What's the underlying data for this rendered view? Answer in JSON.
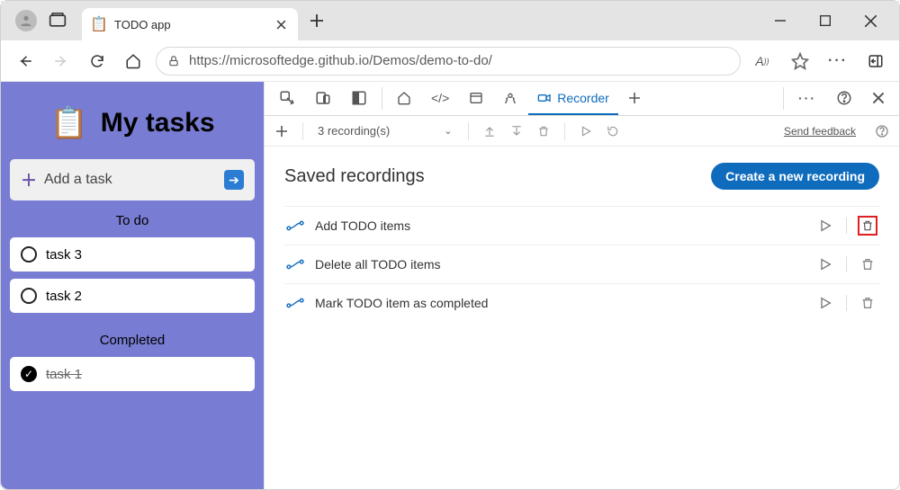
{
  "browser_tab": {
    "title": "TODO app"
  },
  "omnibox": {
    "url": "https://microsoftedge.github.io/Demos/demo-to-do/"
  },
  "app": {
    "title": "My tasks",
    "add_task_label": "Add a task",
    "sections": {
      "todo_label": "To do",
      "completed_label": "Completed"
    },
    "todo": [
      {
        "label": "task 3"
      },
      {
        "label": "task 2"
      }
    ],
    "completed": [
      {
        "label": "task 1"
      }
    ]
  },
  "devtools": {
    "tabs": {
      "recorder_label": "Recorder"
    },
    "recording_count_label": "3 recording(s)",
    "send_feedback_label": "Send feedback",
    "saved_title": "Saved recordings",
    "create_button_label": "Create a new recording",
    "recordings": [
      {
        "name": "Add TODO items",
        "highlight_delete": true
      },
      {
        "name": "Delete all TODO items",
        "highlight_delete": false
      },
      {
        "name": "Mark TODO item as completed",
        "highlight_delete": false
      }
    ]
  }
}
